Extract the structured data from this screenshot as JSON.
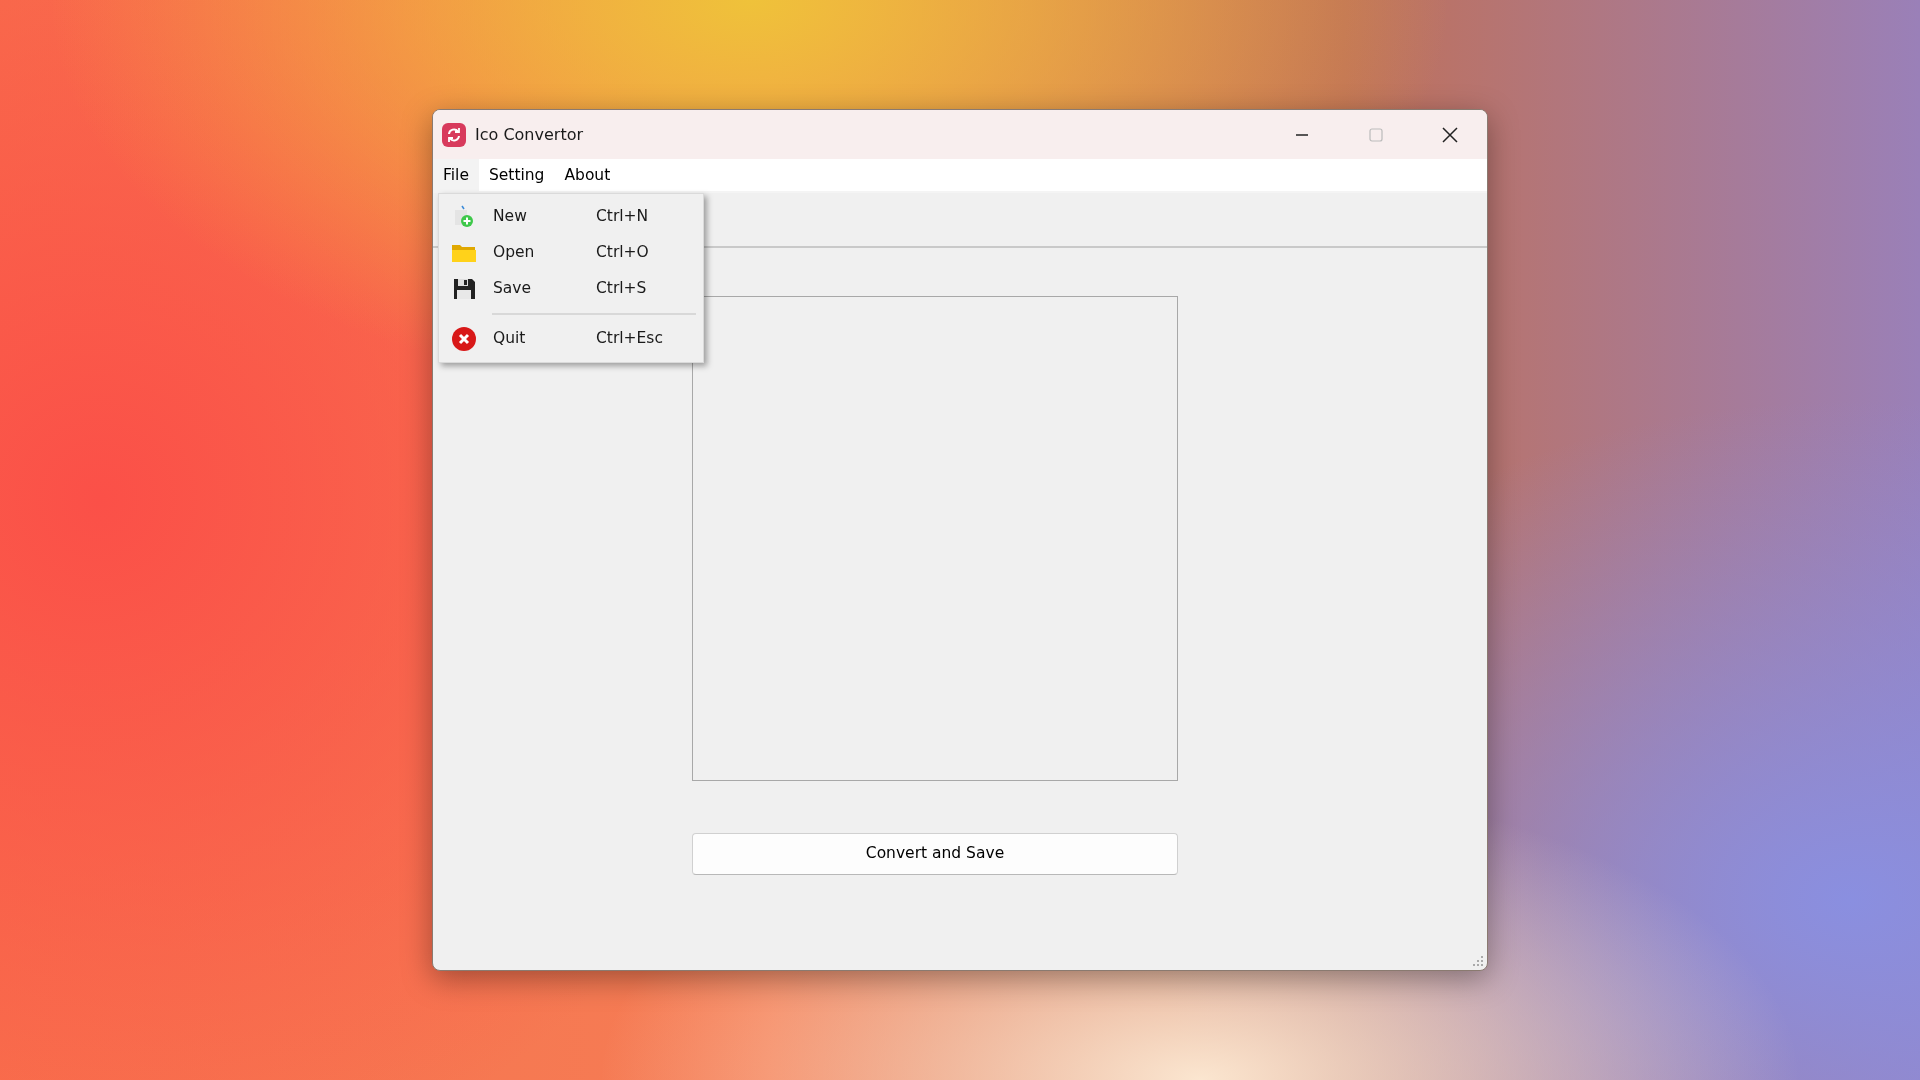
{
  "window": {
    "title": "Ico Convertor"
  },
  "menu_bar": [
    {
      "label": "File",
      "selected": true
    },
    {
      "label": "Setting",
      "selected": false
    },
    {
      "label": "About",
      "selected": false
    }
  ],
  "file_menu": [
    {
      "kind": "item",
      "label": "New",
      "shortcut": "Ctrl+N"
    },
    {
      "kind": "item",
      "label": "Open",
      "shortcut": "Ctrl+O"
    },
    {
      "kind": "item",
      "label": "Save",
      "shortcut": "Ctrl+S"
    },
    {
      "kind": "separator"
    },
    {
      "kind": "item",
      "label": "Quit",
      "shortcut": "Ctrl+Esc"
    }
  ],
  "convert_button": {
    "label": "Convert and Save"
  }
}
